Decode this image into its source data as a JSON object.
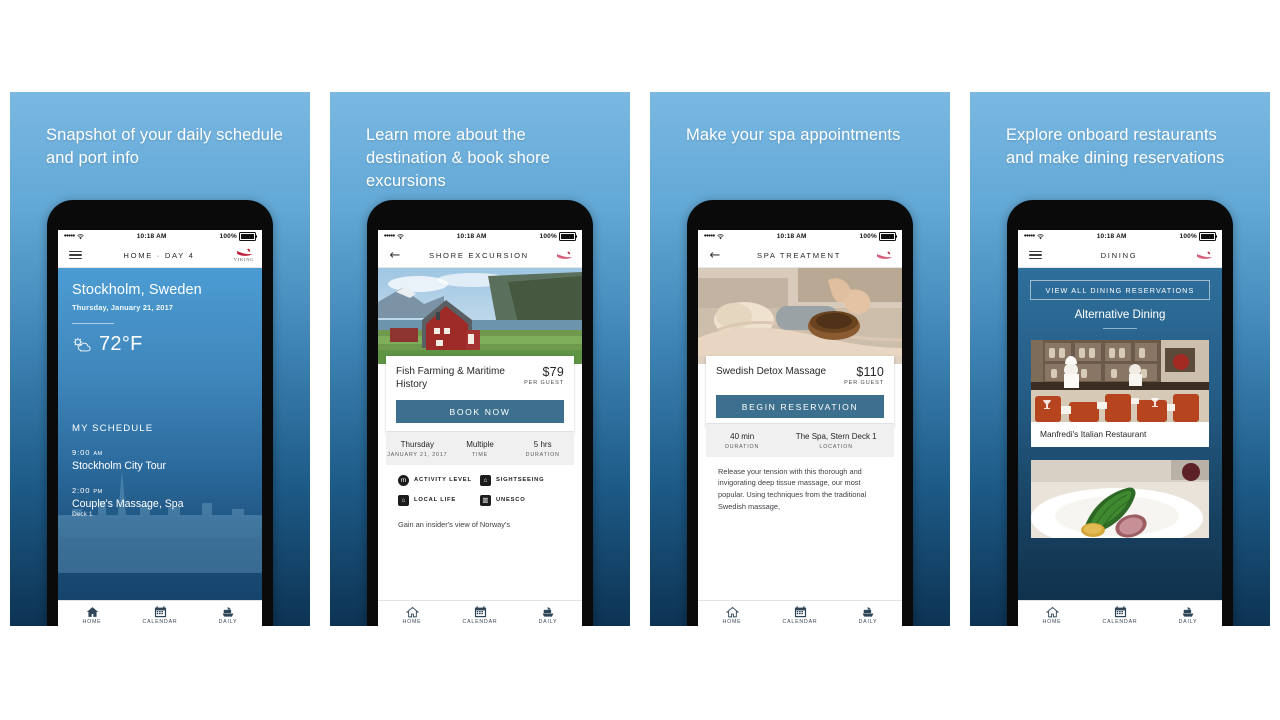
{
  "panels": [
    {
      "headline": "Snapshot of your daily schedule and port info",
      "status": {
        "time": "10:18 AM",
        "battery": "100%",
        "signal": "•••••"
      },
      "nav": {
        "title": "HOME · DAY 4",
        "left_icon": "hamburger-icon",
        "logo": "VIKING"
      },
      "home": {
        "city": "Stockholm, Sweden",
        "date": "Thursday, January 21, 2017",
        "weather_icon": "sun-cloud-icon",
        "temperature": "72°F",
        "schedule_label": "MY SCHEDULE",
        "items": [
          {
            "time": "9:00",
            "meridiem": "AM",
            "name": "Stockholm City Tour",
            "sub": ""
          },
          {
            "time": "2:00",
            "meridiem": "PM",
            "name": "Couple's Massage, Spa",
            "sub": "Deck 1"
          }
        ]
      },
      "tabs": [
        {
          "label": "HOME",
          "icon": "home-icon",
          "active": true
        },
        {
          "label": "CALENDAR",
          "icon": "calendar-icon",
          "active": false
        },
        {
          "label": "DAILY",
          "icon": "ship-icon",
          "active": false
        }
      ]
    },
    {
      "headline": "Learn more about the destination & book shore excursions",
      "status": {
        "time": "10:18 AM",
        "battery": "100%",
        "signal": "•••••"
      },
      "nav": {
        "title": "SHORE EXCURSION",
        "left_icon": "back-arrow-icon",
        "logo": "VIKING"
      },
      "detail": {
        "photo": "norwegian-fjord-red-house-photo",
        "title": "Fish Farming & Maritime History",
        "price": "$79",
        "price_sub": "PER GUEST",
        "cta": "BOOK NOW",
        "meta": [
          {
            "value": "Thursday",
            "label": "JANUARY 21, 2017"
          },
          {
            "value": "Multiple",
            "label": "TIME"
          },
          {
            "value": "5 hrs",
            "label": "DURATION"
          }
        ],
        "tags": [
          {
            "text": "ACTIVITY LEVEL",
            "icon": "activity-level-icon",
            "glyph": "m",
            "round": true
          },
          {
            "text": "SIGHTSEEING",
            "icon": "sightseeing-icon",
            "glyph": "⌂",
            "round": false
          },
          {
            "text": "LOCAL LIFE",
            "icon": "local-life-icon",
            "glyph": "⌂",
            "round": false
          },
          {
            "text": "UNESCO",
            "icon": "unesco-icon",
            "glyph": "▥",
            "round": false
          }
        ],
        "body": "Gain an insider's view of Norway's"
      },
      "tabs": [
        {
          "label": "HOME",
          "icon": "home-icon",
          "active": false
        },
        {
          "label": "CALENDAR",
          "icon": "calendar-icon",
          "active": false
        },
        {
          "label": "DAILY",
          "icon": "ship-icon",
          "active": false
        }
      ]
    },
    {
      "headline": "Make your spa appointments",
      "status": {
        "time": "10:18 AM",
        "battery": "100%",
        "signal": "•••••"
      },
      "nav": {
        "title": "SPA TREATMENT",
        "left_icon": "back-arrow-icon",
        "logo": "VIKING"
      },
      "detail": {
        "photo": "spa-massage-photo",
        "title": "Swedish Detox Massage",
        "price": "$110",
        "price_sub": "PER GUEST",
        "cta": "BEGIN RESERVATION",
        "meta": [
          {
            "value": "40 min",
            "label": "DURATION"
          },
          {
            "value": "The Spa, Stern Deck 1",
            "label": "LOCATION"
          }
        ],
        "tags": [],
        "body": "Release your tension with this thorough and invigorating deep tissue massage, our most popular. Using techniques from the traditional Swedish massage,"
      },
      "tabs": [
        {
          "label": "HOME",
          "icon": "home-icon",
          "active": false
        },
        {
          "label": "CALENDAR",
          "icon": "calendar-icon",
          "active": false
        },
        {
          "label": "DAILY",
          "icon": "ship-icon",
          "active": false
        }
      ]
    },
    {
      "headline": "Explore onboard restaurants and make dining reservations",
      "status": {
        "time": "10:18 AM",
        "battery": "100%",
        "signal": "•••••"
      },
      "nav": {
        "title": "DINING",
        "left_icon": "hamburger-icon",
        "logo": "VIKING"
      },
      "dining": {
        "view_all": "VIEW ALL DINING RESERVATIONS",
        "section_title": "Alternative Dining",
        "restaurants": [
          {
            "name": "Manfredi's Italian Restaurant",
            "photo": "italian-restaurant-interior-photo"
          },
          {
            "name": "",
            "photo": "plated-dish-photo"
          }
        ]
      },
      "tabs": [
        {
          "label": "HOME",
          "icon": "home-icon",
          "active": false
        },
        {
          "label": "CALENDAR",
          "icon": "calendar-icon",
          "active": false
        },
        {
          "label": "DAILY",
          "icon": "ship-icon",
          "active": false
        }
      ]
    }
  ],
  "colors": {
    "panel_top": "#7ab8e2",
    "panel_bottom": "#0d3353",
    "cta": "#3d6f8e",
    "logo_red": "#c0213a",
    "tab_icon": "#3c4a57"
  }
}
